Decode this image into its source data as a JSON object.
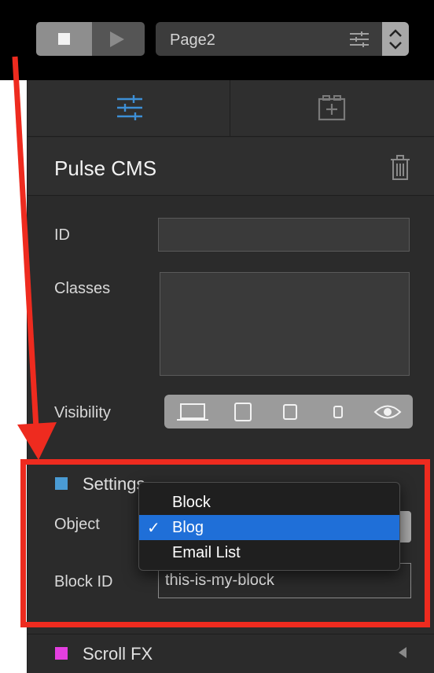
{
  "toolbar": {
    "stop_icon": "stop-square-icon",
    "play_icon": "play-triangle-icon",
    "page_select": {
      "value": "Page2",
      "icon": "sliders-icon",
      "stepper_icon": "chevron-updown-icon"
    }
  },
  "tabs": [
    {
      "name": "settings",
      "icon": "sliders-icon",
      "active": true,
      "color": "#3d8fd6"
    },
    {
      "name": "add",
      "icon": "add-container-icon",
      "active": false
    }
  ],
  "section": {
    "title": "Pulse CMS",
    "delete_icon": "trash-icon"
  },
  "fields": {
    "id_label": "ID",
    "id_value": "",
    "classes_label": "Classes",
    "classes_value": "",
    "visibility_label": "Visibility",
    "visibility_options": [
      "desktop-icon",
      "tablet-landscape-icon",
      "tablet-portrait-icon",
      "phone-icon",
      "eye-icon"
    ]
  },
  "settings": {
    "header": "Settings",
    "header_color": "#4a9bd4",
    "object_label": "Object",
    "block_id_label": "Block ID",
    "block_id_value": "this-is-my-block"
  },
  "dropdown": {
    "options": [
      {
        "label": "Block",
        "selected": false
      },
      {
        "label": "Blog",
        "selected": true,
        "check": "✓"
      },
      {
        "label": "Email List",
        "selected": false
      }
    ],
    "selected_color": "#1f6fd8"
  },
  "scrollfx": {
    "label": "Scroll FX",
    "swatch_color": "#e43fe0",
    "collapse_icon": "chevron-left-icon"
  },
  "annotation": {
    "color": "#ee2b1f"
  }
}
